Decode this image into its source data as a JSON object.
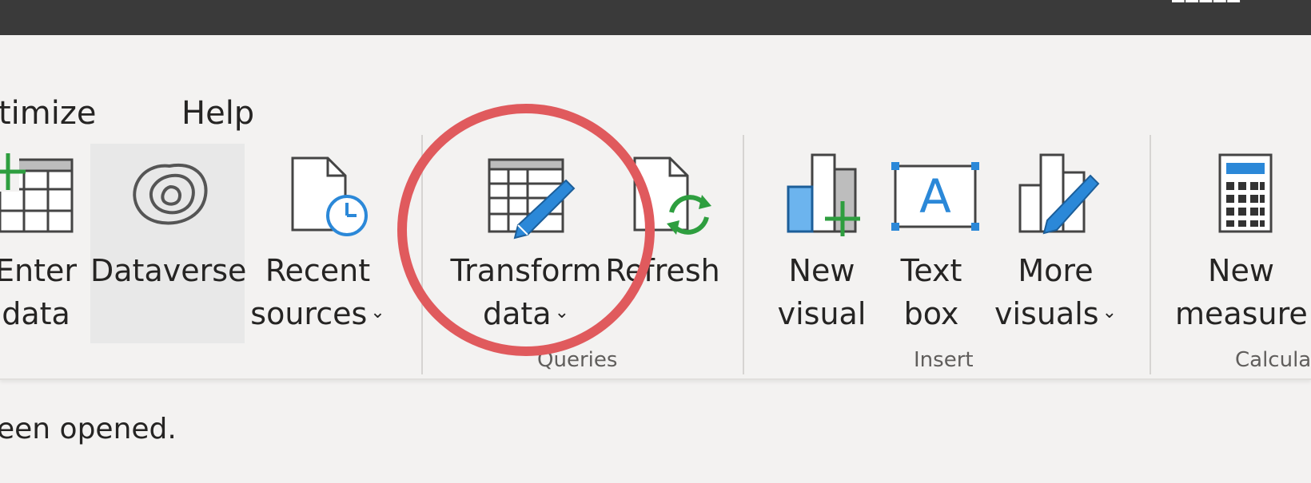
{
  "tabs": {
    "optimize_label": "timize",
    "help_label": "Help"
  },
  "ribbon": {
    "buttons": [
      {
        "line1": "Enter",
        "line2": "data",
        "icon": "table-add-icon"
      },
      {
        "line1": "Dataverse",
        "line2": "",
        "icon": "dataverse-icon"
      },
      {
        "line1": "Recent",
        "line2": "sources",
        "icon": "recent-sources-icon",
        "has_dropdown": true
      },
      {
        "line1": "Transform",
        "line2": "data",
        "icon": "transform-data-icon",
        "has_dropdown": true
      },
      {
        "line1": "Refresh",
        "line2": "",
        "icon": "refresh-icon"
      },
      {
        "line1": "New",
        "line2": "visual",
        "icon": "new-visual-icon"
      },
      {
        "line1": "Text",
        "line2": "box",
        "icon": "text-box-icon"
      },
      {
        "line1": "More",
        "line2": "visuals",
        "icon": "more-visuals-icon",
        "has_dropdown": true
      },
      {
        "line1": "New",
        "line2": "measure",
        "icon": "calculator-icon"
      }
    ],
    "groups": {
      "queries": "Queries",
      "insert": "Insert",
      "calculations": "Calcula"
    }
  },
  "status": {
    "text": "een opened."
  },
  "colors": {
    "title_bar": "#3a3a3a",
    "background": "#f3f2f1",
    "highlight_circle": "#e05a5d",
    "icon_blue": "#2b88d8",
    "icon_green": "#2e9e3f"
  }
}
